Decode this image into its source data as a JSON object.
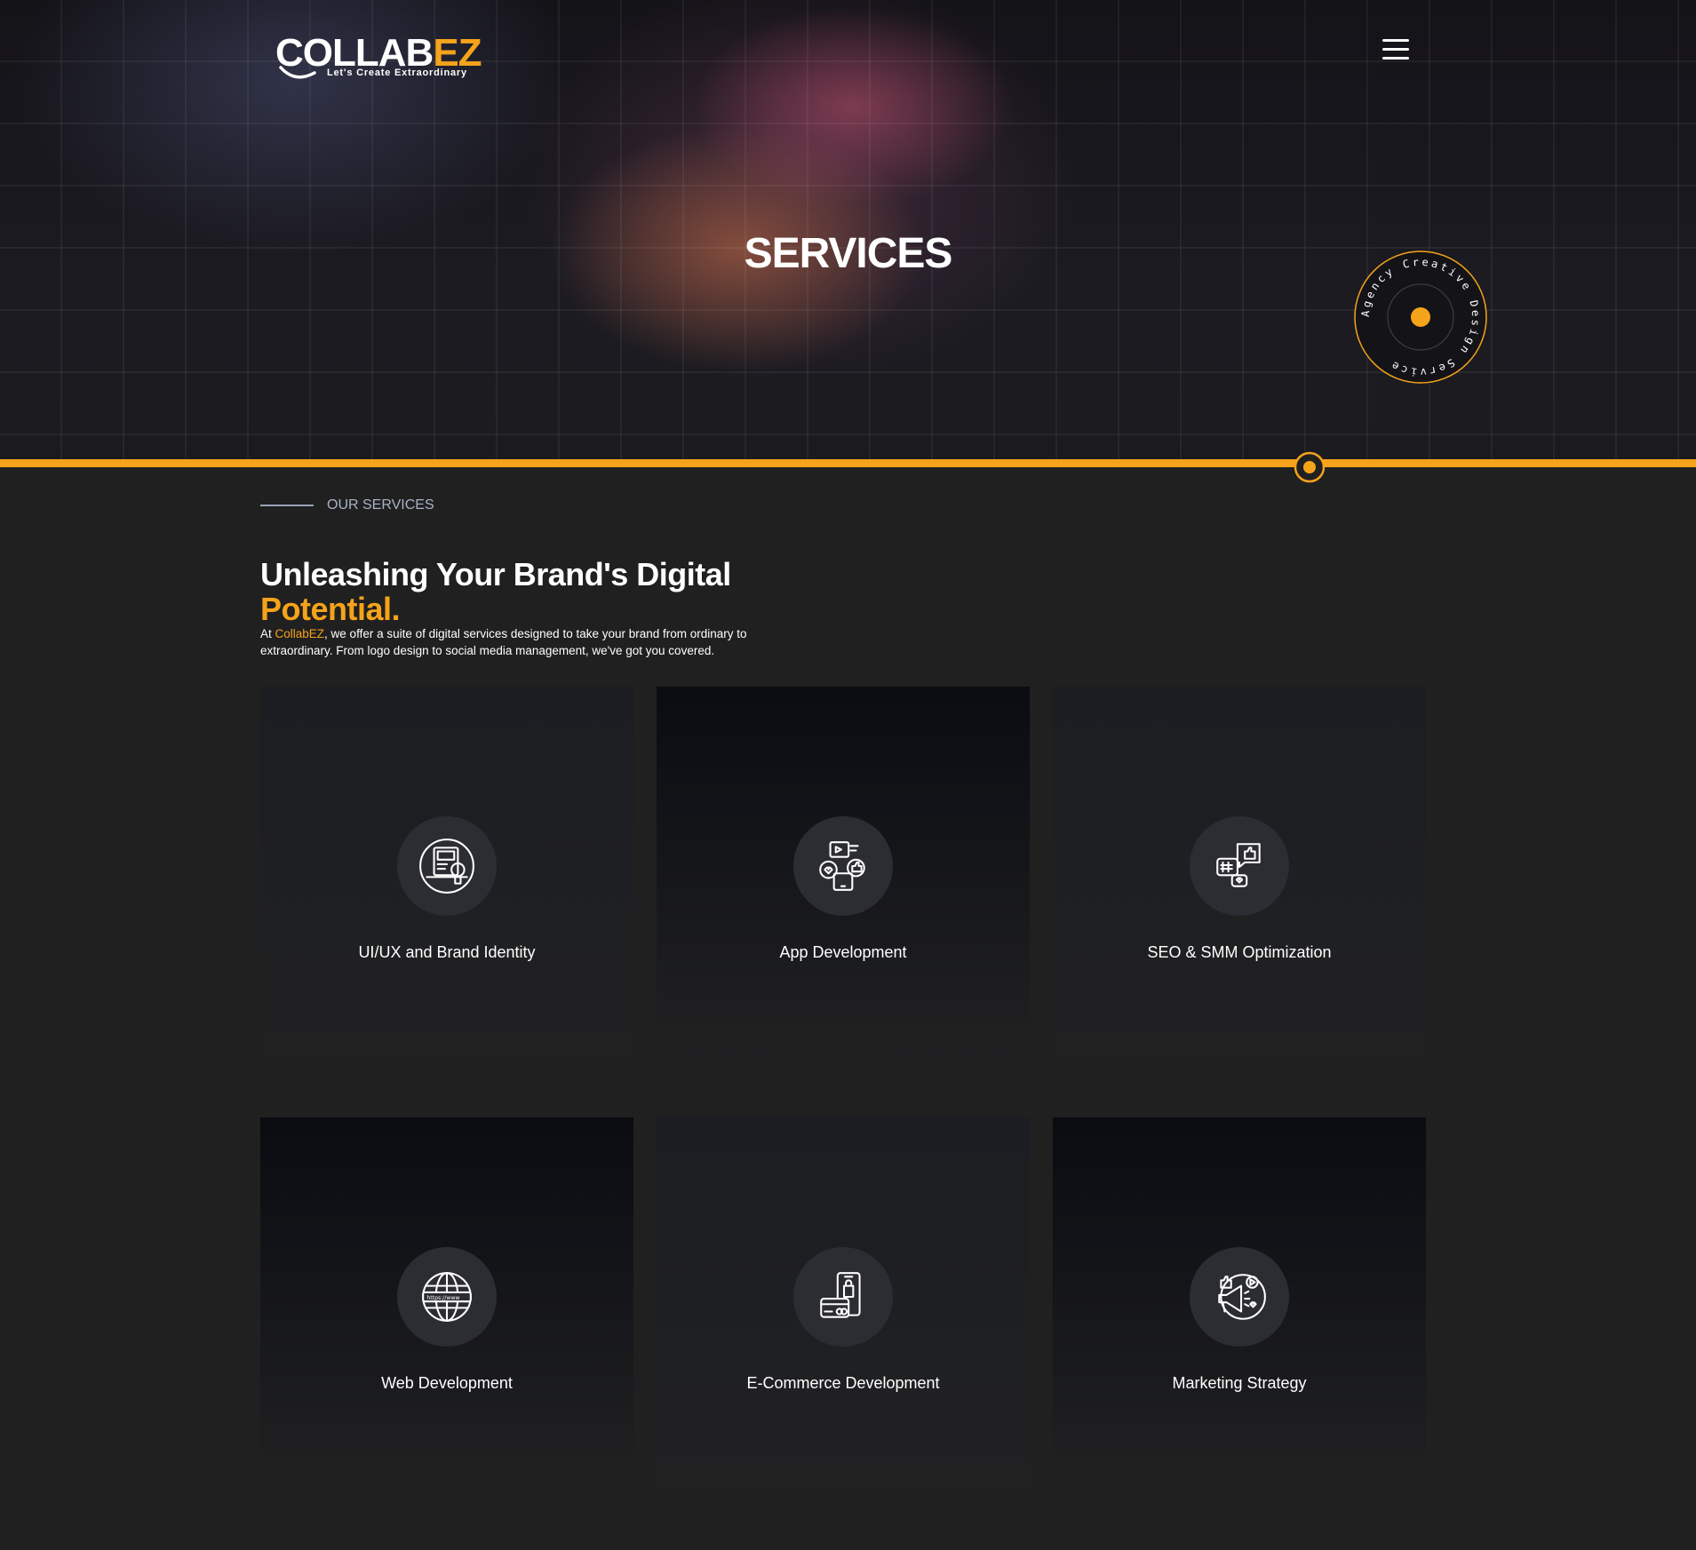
{
  "header": {
    "logo": {
      "word_white": "COLLAB",
      "word_orange": "EZ",
      "tagline": "Let's Create Extraordinary"
    },
    "menu_icon": "hamburger-menu-icon"
  },
  "hero": {
    "title": "SERVICES",
    "badge_text": "Agency Creative Design Service"
  },
  "intro": {
    "eyebrow": "OUR SERVICES",
    "headline_white": "Unleashing Your Brand's Digital",
    "headline_orange": "Potential.",
    "text_prefix": "At ",
    "text_brand": "CollabEZ",
    "text_suffix": ", we offer a suite of digital services designed to take your brand from ordinary to extraordinary. From logo design to social media management, we've got you covered."
  },
  "services": [
    {
      "label": "UI/UX and Brand Identity",
      "icon": "brand-identity-icon"
    },
    {
      "label": "App Development",
      "icon": "app-development-icon"
    },
    {
      "label": "SEO & SMM Optimization",
      "icon": "seo-smm-icon"
    },
    {
      "label": "Web Development",
      "icon": "web-globe-icon"
    },
    {
      "label": "E-Commerce Development",
      "icon": "ecommerce-icon"
    },
    {
      "label": "Marketing Strategy",
      "icon": "marketing-megaphone-icon"
    }
  ],
  "colors": {
    "accent": "#f5a31a",
    "background": "#202020",
    "card_dark": "#0a0c12",
    "card_light": "#1b1d22"
  }
}
